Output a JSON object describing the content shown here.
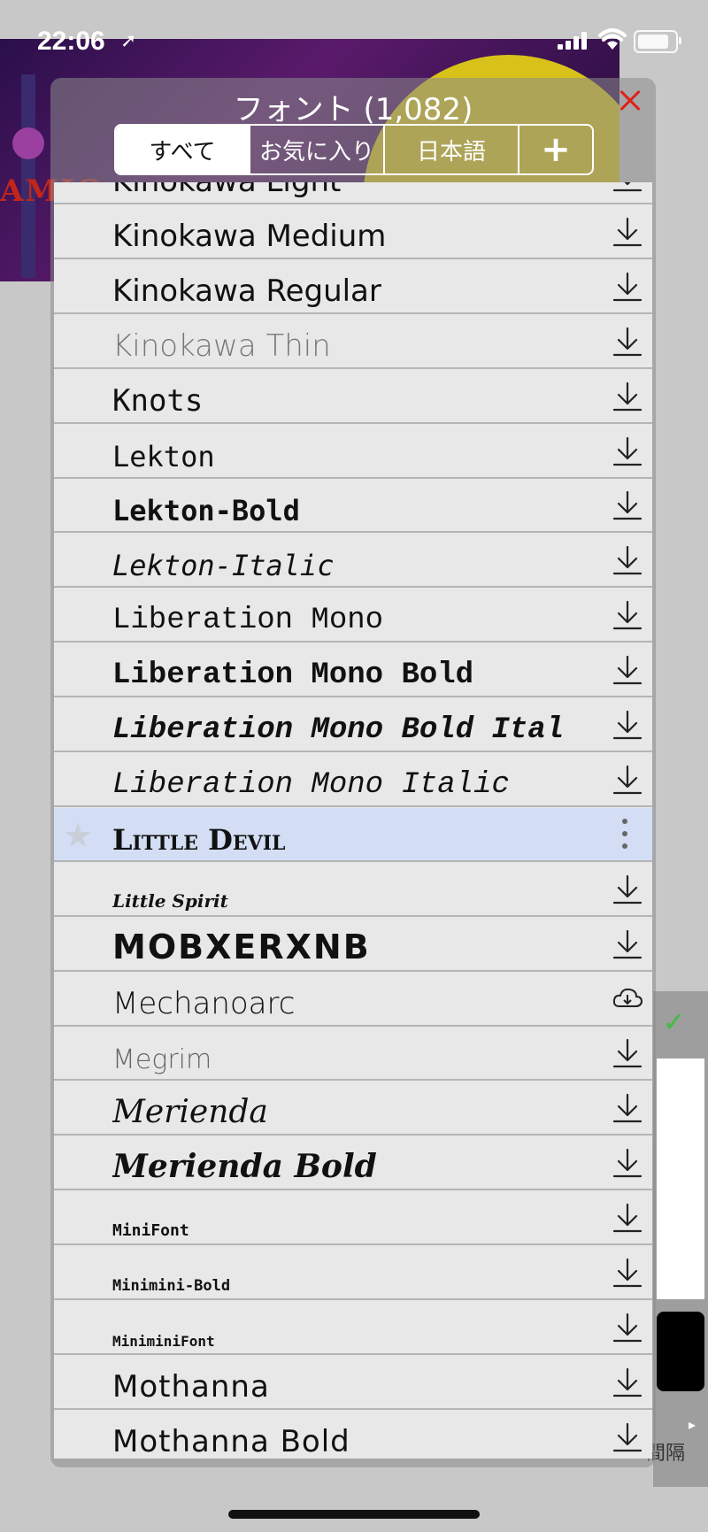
{
  "status_bar": {
    "time": "22:06"
  },
  "background": {
    "sign_text": "AMIC"
  },
  "side_panel": {
    "label": "間隔"
  },
  "dialog": {
    "title": "フォント (1,082)",
    "tabs": [
      {
        "label": "すべて",
        "active": true
      },
      {
        "label": "お気に入り",
        "active": false
      },
      {
        "label": "日本語",
        "active": false
      },
      {
        "label": "+",
        "active": false
      }
    ],
    "fonts": [
      {
        "name": "Kinokawa Light",
        "action": "download"
      },
      {
        "name": "Kinokawa Medium",
        "action": "download"
      },
      {
        "name": "Kinokawa Regular",
        "action": "download"
      },
      {
        "name": "Kinokawa Thin",
        "action": "download"
      },
      {
        "name": "Knots",
        "action": "download"
      },
      {
        "name": "Lekton",
        "action": "download"
      },
      {
        "name": "Lekton-Bold",
        "action": "download"
      },
      {
        "name": "Lekton-Italic",
        "action": "download"
      },
      {
        "name": "Liberation Mono",
        "action": "download"
      },
      {
        "name": "Liberation Mono Bold",
        "action": "download"
      },
      {
        "name": "Liberation Mono Bold Ital",
        "action": "download"
      },
      {
        "name": "Liberation Mono Italic",
        "action": "download"
      },
      {
        "name": "Little Devil",
        "action": "more",
        "selected": true
      },
      {
        "name": "Little Spirit",
        "action": "download"
      },
      {
        "name": "MOBXERXNB",
        "action": "download"
      },
      {
        "name": "Mechanoarc",
        "action": "cloud"
      },
      {
        "name": "Megrim",
        "action": "download"
      },
      {
        "name": "Merienda",
        "action": "download"
      },
      {
        "name": "Merienda Bold",
        "action": "download"
      },
      {
        "name": "MiniFont",
        "action": "download"
      },
      {
        "name": "Minimini-Bold",
        "action": "download"
      },
      {
        "name": "MiniminiFont",
        "action": "download"
      },
      {
        "name": "Mothanna",
        "action": "download"
      },
      {
        "name": "Mothanna Bold",
        "action": "download"
      }
    ]
  }
}
